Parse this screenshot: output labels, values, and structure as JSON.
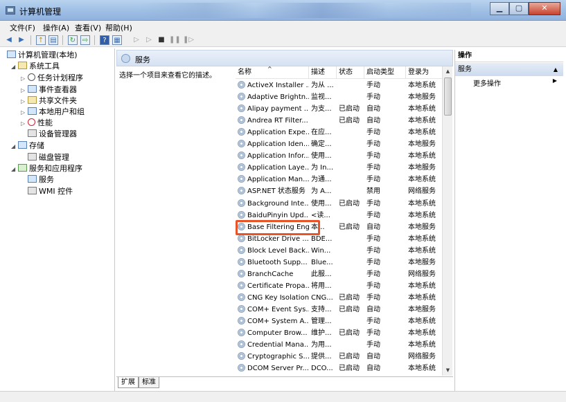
{
  "window": {
    "title": "计算机管理"
  },
  "menu": [
    "文件(F)",
    "操作(A)",
    "查看(V)",
    "帮助(H)"
  ],
  "tree": [
    {
      "label": "计算机管理(本地)",
      "level": 0,
      "arrow": "",
      "icon": "computer-icon"
    },
    {
      "label": "系统工具",
      "level": 1,
      "arrow": "◢",
      "icon": "tools-icon"
    },
    {
      "label": "任务计划程序",
      "level": 2,
      "arrow": "▷",
      "icon": "clock-icon"
    },
    {
      "label": "事件查看器",
      "level": 2,
      "arrow": "▷",
      "icon": "event-viewer-icon"
    },
    {
      "label": "共享文件夹",
      "level": 2,
      "arrow": "▷",
      "icon": "shared-folder-icon"
    },
    {
      "label": "本地用户和组",
      "level": 2,
      "arrow": "▷",
      "icon": "users-icon"
    },
    {
      "label": "性能",
      "level": 2,
      "arrow": "▷",
      "icon": "performance-icon"
    },
    {
      "label": "设备管理器",
      "level": 2,
      "arrow": "",
      "icon": "device-manager-icon"
    },
    {
      "label": "存储",
      "level": 1,
      "arrow": "◢",
      "icon": "storage-icon"
    },
    {
      "label": "磁盘管理",
      "level": 2,
      "arrow": "",
      "icon": "disk-icon"
    },
    {
      "label": "服务和应用程序",
      "level": 1,
      "arrow": "◢",
      "icon": "services-apps-icon"
    },
    {
      "label": "服务",
      "level": 2,
      "arrow": "",
      "icon": "services-icon"
    },
    {
      "label": "WMI 控件",
      "level": 2,
      "arrow": "",
      "icon": "wmi-icon"
    }
  ],
  "center": {
    "header": "服务",
    "description": "选择一个项目来查看它的描述。",
    "columns": [
      "名称",
      "描述",
      "状态",
      "启动类型",
      "登录为"
    ],
    "rows": [
      [
        "ActiveX Installer ...",
        "为从 ...",
        "",
        "手动",
        "本地系统"
      ],
      [
        "Adaptive Brightn...",
        "监视...",
        "",
        "手动",
        "本地服务"
      ],
      [
        "Alipay payment ...",
        "为支...",
        "已启动",
        "自动",
        "本地系统"
      ],
      [
        "Andrea RT Filter...",
        "",
        "已启动",
        "自动",
        "本地系统"
      ],
      [
        "Application Expe...",
        "在应...",
        "",
        "手动",
        "本地系统"
      ],
      [
        "Application Iden...",
        "确定...",
        "",
        "手动",
        "本地服务"
      ],
      [
        "Application Infor...",
        "使用...",
        "",
        "手动",
        "本地系统"
      ],
      [
        "Application Laye...",
        "为 In...",
        "",
        "手动",
        "本地服务"
      ],
      [
        "Application Man...",
        "为通...",
        "",
        "手动",
        "本地系统"
      ],
      [
        "ASP.NET 状态服务",
        "为 A...",
        "",
        "禁用",
        "网络服务"
      ],
      [
        "Background Inte...",
        "使用...",
        "已启动",
        "手动",
        "本地系统"
      ],
      [
        "BaiduPinyin Upd...",
        "<读...",
        "",
        "手动",
        "本地系统"
      ],
      [
        "Base Filtering Engine",
        "本...",
        "已启动",
        "自动",
        "本地服务"
      ],
      [
        "BitLocker Drive ...",
        "BDE...",
        "",
        "手动",
        "本地系统"
      ],
      [
        "Block Level Back...",
        "Win...",
        "",
        "手动",
        "本地系统"
      ],
      [
        "Bluetooth Supp...",
        "Blue...",
        "",
        "手动",
        "本地服务"
      ],
      [
        "BranchCache",
        "此服...",
        "",
        "手动",
        "网络服务"
      ],
      [
        "Certificate Propa...",
        "将用...",
        "",
        "手动",
        "本地系统"
      ],
      [
        "CNG Key Isolation",
        "CNG...",
        "已启动",
        "手动",
        "本地系统"
      ],
      [
        "COM+ Event Sys...",
        "支持...",
        "已启动",
        "自动",
        "本地服务"
      ],
      [
        "COM+ System A...",
        "管理...",
        "",
        "手动",
        "本地系统"
      ],
      [
        "Computer Brow...",
        "维护...",
        "已启动",
        "手动",
        "本地系统"
      ],
      [
        "Credential Mana...",
        "为用...",
        "",
        "手动",
        "本地系统"
      ],
      [
        "Cryptographic S...",
        "提供...",
        "已启动",
        "自动",
        "网络服务"
      ],
      [
        "DCOM Server Pr...",
        "DCO...",
        "已启动",
        "自动",
        "本地系统"
      ]
    ],
    "tabs": [
      "扩展",
      "标准"
    ]
  },
  "actions": {
    "header": "操作",
    "group": "服务",
    "more": "更多操作"
  }
}
